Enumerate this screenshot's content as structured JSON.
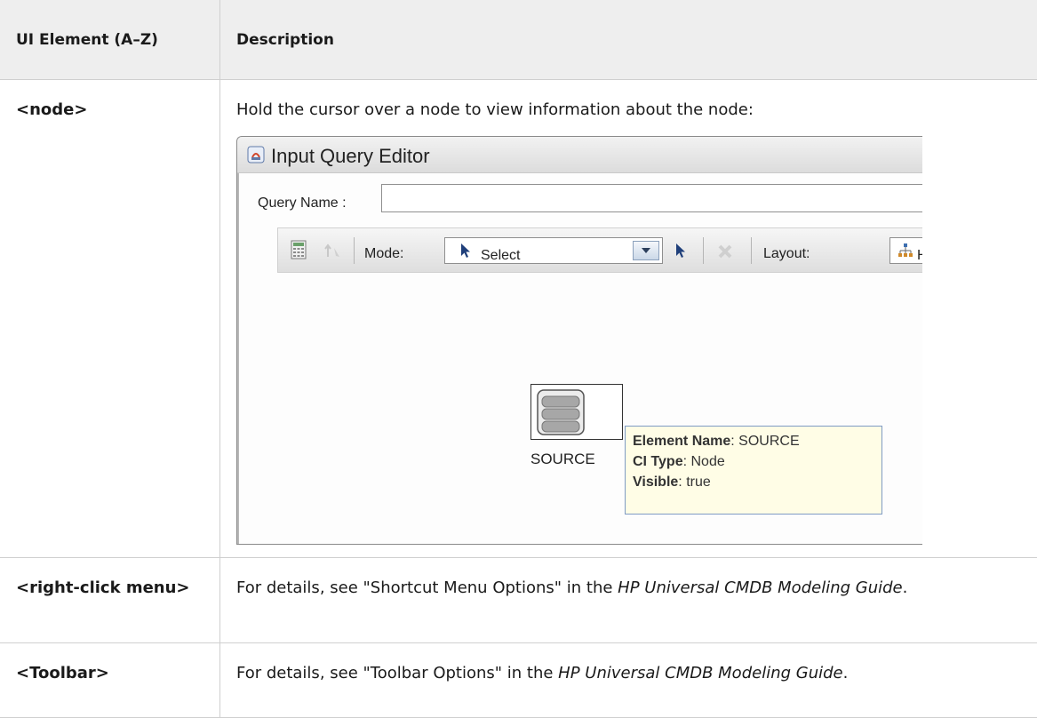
{
  "table": {
    "headers": [
      "UI Element (A–Z)",
      "Description"
    ],
    "rows": [
      {
        "element": "<node>",
        "description": "Hold the cursor over a node to view information about the node:"
      },
      {
        "element": "<right-click menu>",
        "desc_prefix": "For details, see \"Shortcut Menu Options\" in the ",
        "desc_guide": "HP Universal CMDB Modeling Guide",
        "desc_suffix": "."
      },
      {
        "element": "<Toolbar>",
        "desc_prefix": "For details, see \"Toolbar Options\" in the ",
        "desc_guide": "HP Universal CMDB Modeling Guide",
        "desc_suffix": "."
      }
    ]
  },
  "editor": {
    "title": "Input Query Editor",
    "query_name_label": "Query Name :",
    "query_name_value": "",
    "mode_label": "Mode:",
    "mode_value": "Select",
    "layout_label": "Layout:",
    "layout_value": "Hi",
    "node_label": "SOURCE",
    "tooltip": {
      "element_name_key": "Element Name",
      "element_name_value": ": SOURCE",
      "ci_type_key": "CI Type",
      "ci_type_value": ": Node",
      "visible_key": "Visible",
      "visible_value": ": true"
    }
  },
  "colors": {
    "header_bg": "#eeeeee",
    "border": "#cfcfcf",
    "tooltip_bg": "#fffde6"
  }
}
